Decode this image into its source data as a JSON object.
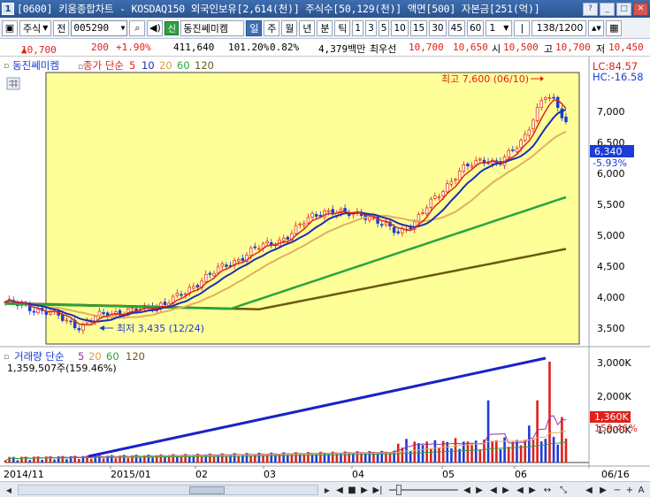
{
  "window": {
    "title": "[0600] 키움종합차트 - KOSDAQ150 외국인보유[2,614(천)] 주식수[50,129(천)] 액면[500] 자본금[251(억)]",
    "icon_label": "1"
  },
  "toolbar": {
    "market": "주식",
    "market_btn": "전",
    "code": "005290",
    "name": "동진쎄미켐",
    "sin_label": "신",
    "periods": [
      "일",
      "주",
      "월",
      "년",
      "분",
      "틱"
    ],
    "selected_period": "일",
    "intervals": [
      "1",
      "3",
      "5",
      "10",
      "15",
      "30",
      "45",
      "60"
    ],
    "multiplier": "1",
    "count": "138/1200"
  },
  "pricebar": {
    "price": "10,700",
    "change": "200",
    "change_rate": "+1.90%",
    "volume": "411,640",
    "vol_ratio": "101.20%",
    "turnover": "0.82%",
    "amount": "4,379백만",
    "tag": "최우선",
    "ask": "10,700",
    "bid": "10,650",
    "open_label": "시",
    "open": "10,500",
    "high_label": "고",
    "high": "10,700",
    "low_label": "저",
    "low": "10,450"
  },
  "price_panel": {
    "stock_label": "동진쎄미켐",
    "ma_label": "종가 단순",
    "ma_periods": [
      "5",
      "10",
      "20",
      "60",
      "120"
    ],
    "ma_colors": [
      "#e02323",
      "#1c2fb0",
      "#e0b060",
      "#2aa53a",
      "#6b5a10"
    ],
    "lc": "LC:84.57",
    "hc": "HC:-16.58",
    "max_annotation": "최고 7,600 (06/10)",
    "min_annotation": "최저 3,435 (12/24)",
    "current_price": "6,340",
    "current_rate": "-5.93%",
    "y_ticks": [
      "7,000",
      "6,500",
      "6,000",
      "5,500",
      "5,000",
      "4,500",
      "4,000",
      "3,500"
    ]
  },
  "volume_panel": {
    "label": "거래량 단순",
    "ma_periods": [
      "5",
      "20",
      "60",
      "120"
    ],
    "ma_colors": [
      "#9a2fa8",
      "#e0b060",
      "#2aa53a",
      "#6b5a10"
    ],
    "value": "1,359,507주(159.46%)",
    "current": "1,360K",
    "current_rate": "159.46%",
    "y_ticks": [
      "3,000K",
      "2,000K",
      "1,000K"
    ]
  },
  "x_axis": {
    "labels": [
      "2014/11",
      "2015/01",
      "02",
      "03",
      "04",
      "05",
      "06",
      "06/16"
    ]
  },
  "colors": {
    "up": "#e0201b",
    "down": "#1c3cd6",
    "chart_bg": "#ffff99",
    "trendline": "#1a22c8"
  }
}
